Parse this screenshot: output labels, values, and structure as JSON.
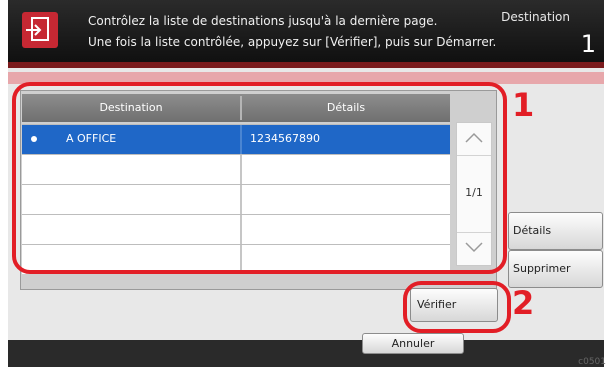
{
  "header": {
    "message_line1": "Contrôlez la liste de destinations jusqu'à la dernière page.",
    "message_line2": "Une fois la liste contrôlée, appuyez sur [Vérifier], puis sur Démarrer.",
    "destination_label": "Destination",
    "destination_count": "1"
  },
  "list": {
    "columns": [
      "Destination",
      "Détails"
    ],
    "rows": [
      {
        "destination": "A OFFICE",
        "details": "1234567890",
        "selected": true
      },
      {
        "destination": "",
        "details": "",
        "selected": false
      },
      {
        "destination": "",
        "details": "",
        "selected": false
      },
      {
        "destination": "",
        "details": "",
        "selected": false
      },
      {
        "destination": "",
        "details": "",
        "selected": false
      }
    ],
    "page_indicator": "1/1"
  },
  "buttons": {
    "details": "Détails",
    "delete": "Supprimer",
    "verify": "Vérifier",
    "cancel": "Annuler"
  },
  "callouts": {
    "n1": "1",
    "n2": "2"
  },
  "image_code": "c0501"
}
